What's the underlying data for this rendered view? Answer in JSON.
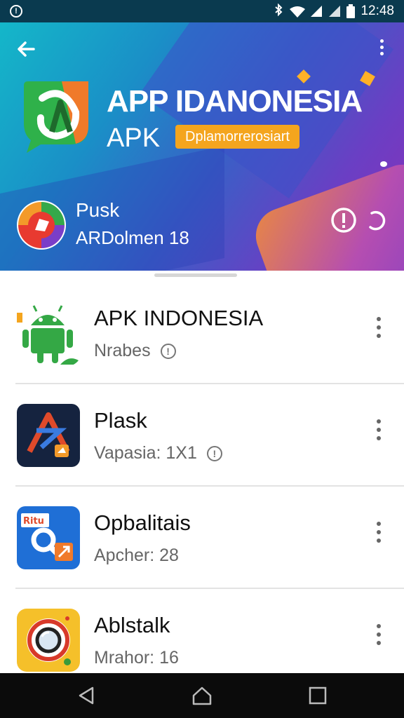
{
  "status_bar": {
    "time": "12:48",
    "left_icon": "notification-icon",
    "icons": [
      "bluetooth-icon",
      "wifi-icon",
      "signal-icon",
      "battery-icon"
    ]
  },
  "hero": {
    "title": "APP IDANONESIA",
    "subtitle": "APK",
    "badge": "Dplamorrerosiart",
    "app_name": "Pusk",
    "app_meta": "ARDolmen 18",
    "colors": {
      "gradient_start": "#14b7c9",
      "gradient_end": "#8a2fb8",
      "accent": "#f4a51e"
    }
  },
  "apps": [
    {
      "title": "APK  INDONESIA",
      "subtitle": "Nrabes",
      "has_info_icon": true,
      "icon": "android-robot-icon"
    },
    {
      "title": "Plask",
      "subtitle": "Vapasia: 1X1",
      "has_info_icon": true,
      "icon": "a-logo-icon"
    },
    {
      "title": "Opbalitais",
      "subtitle": "Apcher: 28",
      "has_info_icon": false,
      "icon": "magnifier-app-icon"
    },
    {
      "title": "Ablstalk",
      "subtitle": "Mrahor: 16",
      "has_info_icon": false,
      "icon": "camera-lens-icon"
    }
  ],
  "navigation": [
    "back-triangle-icon",
    "home-icon",
    "recents-square-icon"
  ]
}
